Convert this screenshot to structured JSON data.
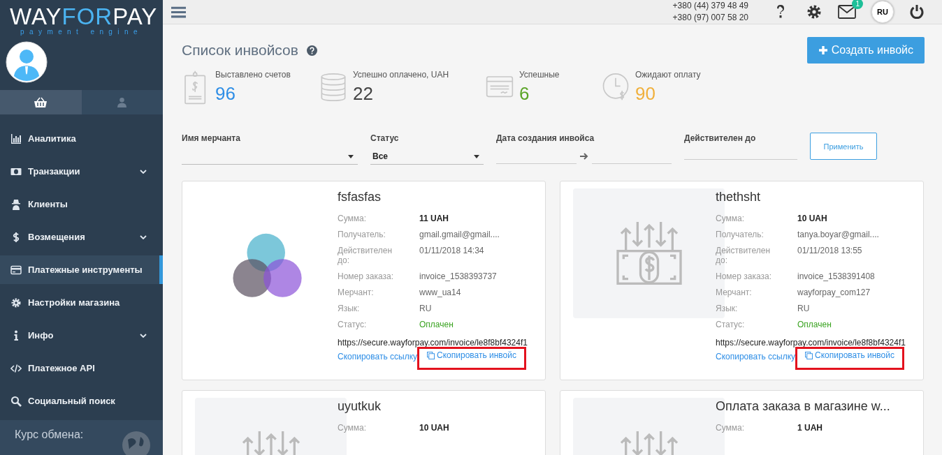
{
  "brand": {
    "logo": [
      {
        "text": "WAY",
        "accent": false
      },
      {
        "text": "FOR",
        "accent": true
      },
      {
        "text": "PAY",
        "accent": false
      }
    ],
    "tagline": "payment engine"
  },
  "sidebar": {
    "tabs": [
      {
        "kind": "basket",
        "selected": true
      },
      {
        "kind": "user",
        "selected": false
      }
    ],
    "items": [
      {
        "label": "Аналитика",
        "kind": "chart",
        "submenu": false,
        "selected": false
      },
      {
        "label": "Транзакции",
        "kind": "money",
        "submenu": true,
        "selected": false
      },
      {
        "label": "Клиенты",
        "kind": "spy",
        "submenu": false,
        "selected": false
      },
      {
        "label": "Возмещения",
        "kind": "dollar",
        "submenu": true,
        "selected": false
      },
      {
        "label": "Платежные инструменты",
        "kind": "card",
        "submenu": false,
        "selected": true
      },
      {
        "label": "Настройки магазина",
        "kind": "gear",
        "submenu": false,
        "selected": false
      },
      {
        "label": "Инфо",
        "kind": "info",
        "submenu": true,
        "selected": false
      },
      {
        "label": "Платежное API",
        "kind": "code",
        "submenu": false,
        "selected": false
      },
      {
        "label": "Социальный поиск",
        "kind": "search",
        "submenu": false,
        "selected": false
      }
    ],
    "exchange_label": "Курс обмена:"
  },
  "header": {
    "phones": [
      "+380 (44) 379 48 49",
      "+380 (97) 007 58 20"
    ],
    "mail_badge": "1",
    "language": "RU"
  },
  "page": {
    "title": "Список инвойсов",
    "create_button": "Создать инвойс"
  },
  "stats": [
    {
      "kind": "receipt",
      "label": "Выставлено счетов",
      "value": "96",
      "color": "#2e8ee6"
    },
    {
      "kind": "coins",
      "label": "Успешно оплачено, UAH",
      "value": "22",
      "color": "#444444"
    },
    {
      "kind": "check",
      "label": "Успешные",
      "value": "6",
      "color": "#5aa427"
    },
    {
      "kind": "clock",
      "label": "Ожидают оплату",
      "value": "90",
      "color": "#f0b03c"
    }
  ],
  "filters": {
    "merchant_label": "Имя мерчанта",
    "status_label": "Статус",
    "status_value": "Все",
    "created_label": "Дата создания инвойса",
    "valid_label": "Действителен до",
    "apply_button": "Применить"
  },
  "cards": [
    {
      "title": "fsfasfas",
      "kind": "circles",
      "highlighted": true,
      "fields": [
        {
          "label": "Сумма:",
          "value": "11 UAH",
          "kind": "bold"
        },
        {
          "label": "Получатель:",
          "value": "gmail.gmail@gmail....",
          "kind": "plain"
        },
        {
          "label": "Действителен до:",
          "value": "01/11/2018 14:34",
          "kind": "plain"
        },
        {
          "label": "Номер заказа:",
          "value": "invoice_1538393737",
          "kind": "plain"
        },
        {
          "label": "Мерчант:",
          "value": "www_ua14",
          "kind": "plain"
        },
        {
          "label": "Язык:",
          "value": "RU",
          "kind": "plain"
        },
        {
          "label": "Статус:",
          "value": "Оплачен",
          "kind": "status"
        }
      ],
      "url": "https://secure.wayforpay.com/invoice/le8f8bf4324f1",
      "copy_link": "Скопировать ссылку",
      "copy_invoice": "Скопировать инвойс"
    },
    {
      "title": "thethsht",
      "kind": "money",
      "highlighted": true,
      "fields": [
        {
          "label": "Сумма:",
          "value": "10 UAH",
          "kind": "bold"
        },
        {
          "label": "Получатель:",
          "value": "tanya.boyar@gmail....",
          "kind": "plain"
        },
        {
          "label": "Действителен до:",
          "value": "01/11/2018 13:55",
          "kind": "plain"
        },
        {
          "label": "Номер заказа:",
          "value": "invoice_1538391408",
          "kind": "plain"
        },
        {
          "label": "Мерчант:",
          "value": "wayforpay_com127",
          "kind": "plain"
        },
        {
          "label": "Язык:",
          "value": "RU",
          "kind": "plain"
        },
        {
          "label": "Статус:",
          "value": "Оплачен",
          "kind": "status"
        }
      ],
      "url": "https://secure.wayforpay.com/invoice/le8f8bf4324f1",
      "copy_link": "Скопировать ссылку",
      "copy_invoice": "Скопировать инвойс"
    },
    {
      "title": "uyutkuk",
      "kind": "money",
      "fields": [
        {
          "label": "Сумма:",
          "value": "10 UAH",
          "kind": "bold"
        }
      ]
    },
    {
      "title": "Оплата заказа в магазине w...",
      "kind": "money",
      "fields": [
        {
          "label": "Сумма:",
          "value": "1 UAH",
          "kind": "bold"
        }
      ]
    }
  ]
}
